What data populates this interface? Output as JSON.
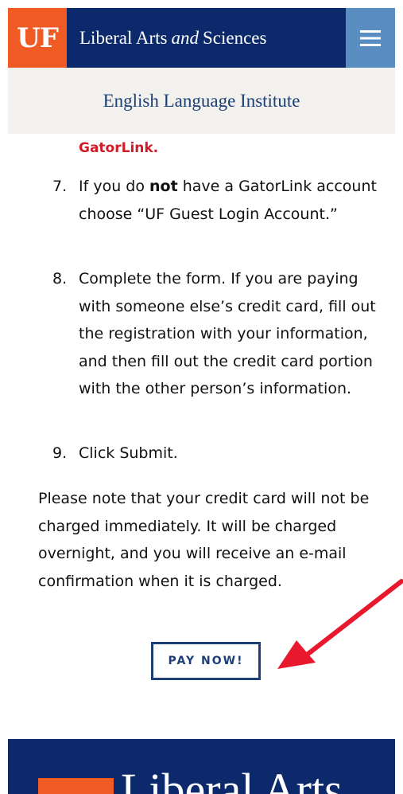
{
  "header": {
    "logo": "UF",
    "title_part1": "Liberal Arts",
    "title_em": "and",
    "title_part2": "Sciences",
    "menu_icon": "hamburger-menu-icon"
  },
  "subheader": {
    "title": "English Language Institute"
  },
  "content": {
    "gatorlink_tail": "GatorLink.",
    "steps": [
      {
        "num": "7.",
        "pre": "If you do ",
        "bold": "not",
        "post": " have a GatorLink account choose “UF Guest Login Account.”"
      },
      {
        "num": "8.",
        "text": "Complete the form. If you are paying with someone else’s credit card, fill out the registration with your information, and then fill out the credit card portion with the other person’s information."
      },
      {
        "num": "9.",
        "text": "Click Submit."
      }
    ],
    "note": "Please note that your credit card will not be charged immediately. It will be charged overnight, and you will receive an e-mail confirmation when it is charged.",
    "pay_button": "PAY NOW!"
  },
  "annotation": {
    "arrow_color": "#e8192c"
  },
  "footer": {
    "title": "Liberal Arts"
  },
  "colors": {
    "navy": "#0c2a6b",
    "orange": "#f05a23",
    "light_blue": "#5a8ec2",
    "red": "#d01c2a"
  }
}
